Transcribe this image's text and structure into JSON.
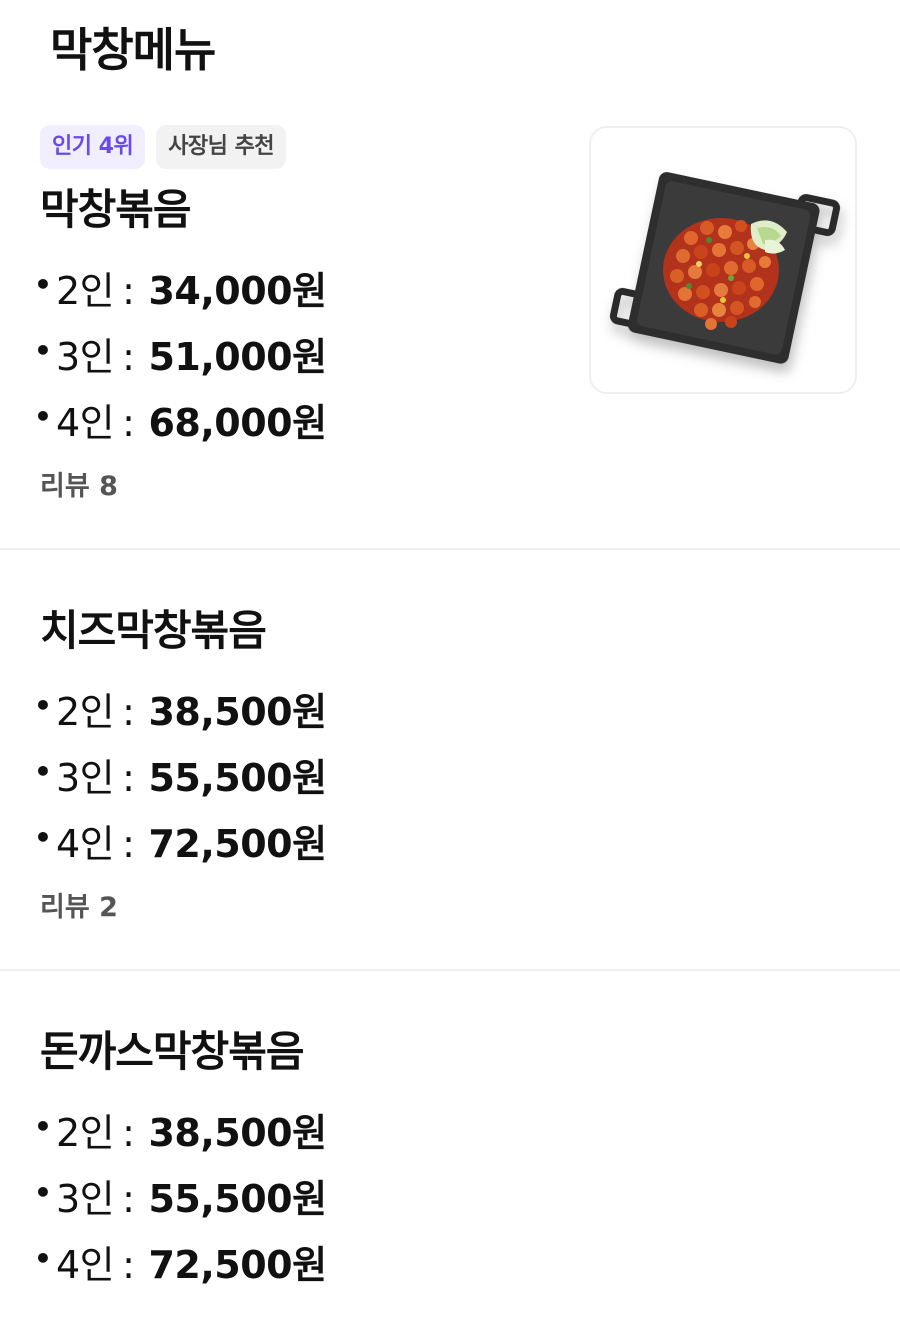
{
  "header": {
    "title": "막창메뉴"
  },
  "items": [
    {
      "badges": [
        "인기 4위",
        "사장님 추천"
      ],
      "name": "막창볶음",
      "prices": [
        {
          "persons": "2인",
          "price": "34,000원"
        },
        {
          "persons": "3인",
          "price": "51,000원"
        },
        {
          "persons": "4인",
          "price": "68,000원"
        }
      ],
      "review": "리뷰 8",
      "image_icon": "stir-fried-makchang-dish-icon"
    },
    {
      "name": "치즈막창볶음",
      "prices": [
        {
          "persons": "2인",
          "price": "38,500원"
        },
        {
          "persons": "3인",
          "price": "55,500원"
        },
        {
          "persons": "4인",
          "price": "72,500원"
        }
      ],
      "review": "리뷰 2"
    },
    {
      "name": "돈까스막창볶음",
      "prices": [
        {
          "persons": "2인",
          "price": "38,500원"
        },
        {
          "persons": "3인",
          "price": "55,500원"
        },
        {
          "persons": "4인",
          "price": "72,500원"
        }
      ]
    }
  ],
  "colors": {
    "rank_badge_bg": "#f1efff",
    "rank_badge_text": "#6a4bea",
    "rec_badge_bg": "#f2f2f3",
    "divider": "#eeeeee"
  }
}
